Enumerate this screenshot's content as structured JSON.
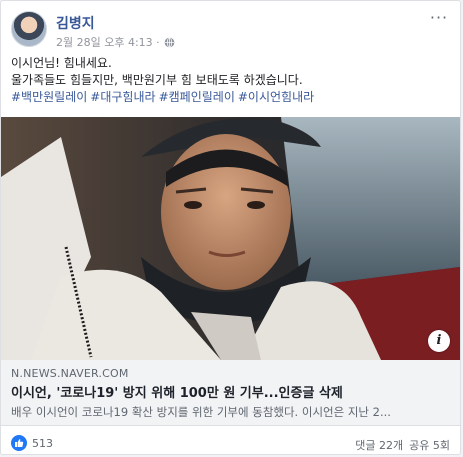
{
  "post": {
    "author": "김병지",
    "timestamp": "2월 28일 오후 4:13 ·",
    "privacy_icon": "globe-icon",
    "more_label": "···",
    "text_lines": [
      "이시언님! 힘내세요.",
      "울가족들도 힘들지만, 백만원기부 힘 보태도록 하겠습니다."
    ],
    "hashtags": [
      "#백만원릴레이",
      "#대구힘내라",
      "#캠페인릴레이",
      "#이시언힘내라"
    ]
  },
  "link": {
    "domain": "N.NEWS.NAVER.COM",
    "title": "이시언, '코로나19' 방지 위해 100만 원 기부...인증글 삭제",
    "description": "배우 이시언이 코로나19 확산 방지를 위한 기부에 동참했다. 이시언은 지난 2...",
    "info_icon": "i"
  },
  "reactions": {
    "like_count": "513",
    "comments": "댓글 22개",
    "shares": "공유 5회"
  },
  "colors": {
    "link_blue": "#385898",
    "like_blue": "#2078f4",
    "card_bg": "#f2f3f5"
  }
}
